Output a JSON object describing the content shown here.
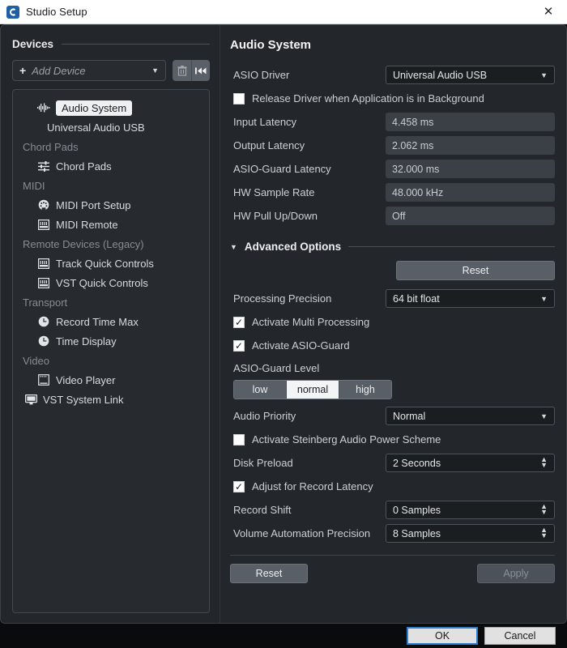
{
  "window": {
    "title": "Studio Setup",
    "app_icon": "cubase-icon",
    "close_icon": "close-icon"
  },
  "devices_panel": {
    "header": "Devices",
    "add_device": {
      "label": "Add Device",
      "plus_icon": "plus-icon",
      "caret_icon": "chevron-down-icon"
    },
    "tool_buttons": [
      {
        "name": "delete-device-button",
        "icon": "trash-icon"
      },
      {
        "name": "reset-device-button",
        "icon": "rewind-icon"
      }
    ],
    "tree": [
      {
        "label": "Audio System",
        "icon": "waveform-icon",
        "level": "child",
        "selected": true
      },
      {
        "label": "Universal Audio USB",
        "icon": "",
        "level": "child2",
        "selected": false
      },
      {
        "label": "Chord Pads",
        "icon": "",
        "level": "group",
        "selected": false
      },
      {
        "label": "Chord Pads",
        "icon": "sliders-icon",
        "level": "child",
        "selected": false
      },
      {
        "label": "MIDI",
        "icon": "",
        "level": "group",
        "selected": false
      },
      {
        "label": "MIDI Port Setup",
        "icon": "midi-port-icon",
        "level": "child",
        "selected": false
      },
      {
        "label": "MIDI Remote",
        "icon": "keyboard-icon",
        "level": "child",
        "selected": false
      },
      {
        "label": "Remote Devices (Legacy)",
        "icon": "",
        "level": "group",
        "selected": false
      },
      {
        "label": "Track Quick Controls",
        "icon": "keyboard-icon",
        "level": "child",
        "selected": false
      },
      {
        "label": "VST Quick Controls",
        "icon": "keyboard-icon",
        "level": "child",
        "selected": false
      },
      {
        "label": "Transport",
        "icon": "",
        "level": "group",
        "selected": false
      },
      {
        "label": "Record Time Max",
        "icon": "clock-icon",
        "level": "child",
        "selected": false
      },
      {
        "label": "Time Display",
        "icon": "clock-icon",
        "level": "child",
        "selected": false
      },
      {
        "label": "Video",
        "icon": "",
        "level": "group",
        "selected": false
      },
      {
        "label": "Video Player",
        "icon": "film-icon",
        "level": "child",
        "selected": false
      },
      {
        "label": "VST System Link",
        "icon": "monitor-icon",
        "level": "child-root",
        "selected": false
      }
    ]
  },
  "audio_system": {
    "title": "Audio System",
    "asio_driver": {
      "label": "ASIO Driver",
      "value": "Universal Audio USB"
    },
    "release_driver": {
      "label": "Release Driver when Application is in Background",
      "checked": false
    },
    "readouts": [
      {
        "label": "Input Latency",
        "value": "4.458 ms"
      },
      {
        "label": "Output Latency",
        "value": "2.062 ms"
      },
      {
        "label": "ASIO-Guard Latency",
        "value": "32.000 ms"
      },
      {
        "label": "HW Sample Rate",
        "value": "48.000 kHz"
      },
      {
        "label": "HW Pull Up/Down",
        "value": "Off"
      }
    ],
    "advanced": {
      "header": "Advanced Options",
      "expand_icon": "triangle-down-icon",
      "reset_label": "Reset",
      "processing_precision": {
        "label": "Processing Precision",
        "value": "64 bit float"
      },
      "multi_processing": {
        "label": "Activate Multi Processing",
        "checked": true
      },
      "asio_guard": {
        "label": "Activate ASIO-Guard",
        "checked": true
      },
      "asio_guard_level": {
        "label": "ASIO-Guard Level",
        "options": [
          "low",
          "normal",
          "high"
        ],
        "selected": "normal"
      },
      "audio_priority": {
        "label": "Audio Priority",
        "value": "Normal"
      },
      "power_scheme": {
        "label": "Activate Steinberg Audio Power Scheme",
        "checked": false
      },
      "disk_preload": {
        "label": "Disk Preload",
        "value": "2 Seconds"
      },
      "adjust_record_latency": {
        "label": "Adjust for Record Latency",
        "checked": true
      },
      "record_shift": {
        "label": "Record Shift",
        "value": "0 Samples"
      },
      "volume_automation_precision": {
        "label": "Volume Automation Precision",
        "value": "8 Samples"
      }
    },
    "footer": {
      "reset_label": "Reset",
      "apply_label": "Apply",
      "apply_disabled": true
    }
  },
  "dialog_buttons": {
    "ok": "OK",
    "cancel": "Cancel"
  },
  "colors": {
    "accent": "#2f7fd1",
    "panel": "#23272b",
    "selection": "#eef0f1"
  }
}
